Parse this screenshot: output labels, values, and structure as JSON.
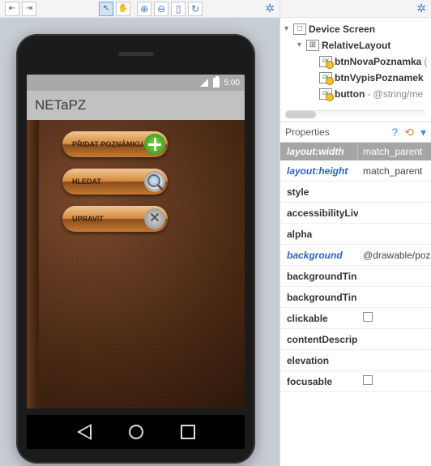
{
  "toolbar": {
    "icons": [
      "align-left-icon",
      "align-right-icon",
      "select-icon",
      "pan-icon",
      "zoom-in-icon",
      "zoom-out-icon",
      "refresh-icon",
      "reset-icon",
      "settings-icon"
    ]
  },
  "phone": {
    "status_time": "5:00",
    "app_title": "NETaPZ",
    "buttons": [
      {
        "label": "PŘIDAT POZNÁMKU",
        "icon": "add-icon"
      },
      {
        "label": "HLEDAT",
        "icon": "search-icon"
      },
      {
        "label": "UPRAVIT",
        "icon": "tools-icon"
      }
    ]
  },
  "tree": {
    "root": "Device Screen",
    "layout": "RelativeLayout",
    "children": [
      {
        "name": "btnNovaPoznamka",
        "suffix": "("
      },
      {
        "name": "btnVypisPoznamek",
        "suffix": ""
      },
      {
        "name": "button",
        "suffix": " - @string/me"
      }
    ]
  },
  "properties": {
    "title": "Properties",
    "header": {
      "col1": "layout:width",
      "col2": "match_parent"
    },
    "rows": [
      {
        "name": "layout:height",
        "value": "match_parent",
        "link": true
      },
      {
        "name": "style",
        "value": ""
      },
      {
        "name": "accessibilityLiv",
        "value": ""
      },
      {
        "name": "alpha",
        "value": ""
      },
      {
        "name": "background",
        "value": "@drawable/pozna",
        "link": true
      },
      {
        "name": "backgroundTin",
        "value": ""
      },
      {
        "name": "backgroundTin",
        "value": ""
      },
      {
        "name": "clickable",
        "value": "",
        "checkbox": true
      },
      {
        "name": "contentDescrip",
        "value": ""
      },
      {
        "name": "elevation",
        "value": ""
      },
      {
        "name": "focusable",
        "value": "",
        "checkbox": true
      }
    ]
  }
}
